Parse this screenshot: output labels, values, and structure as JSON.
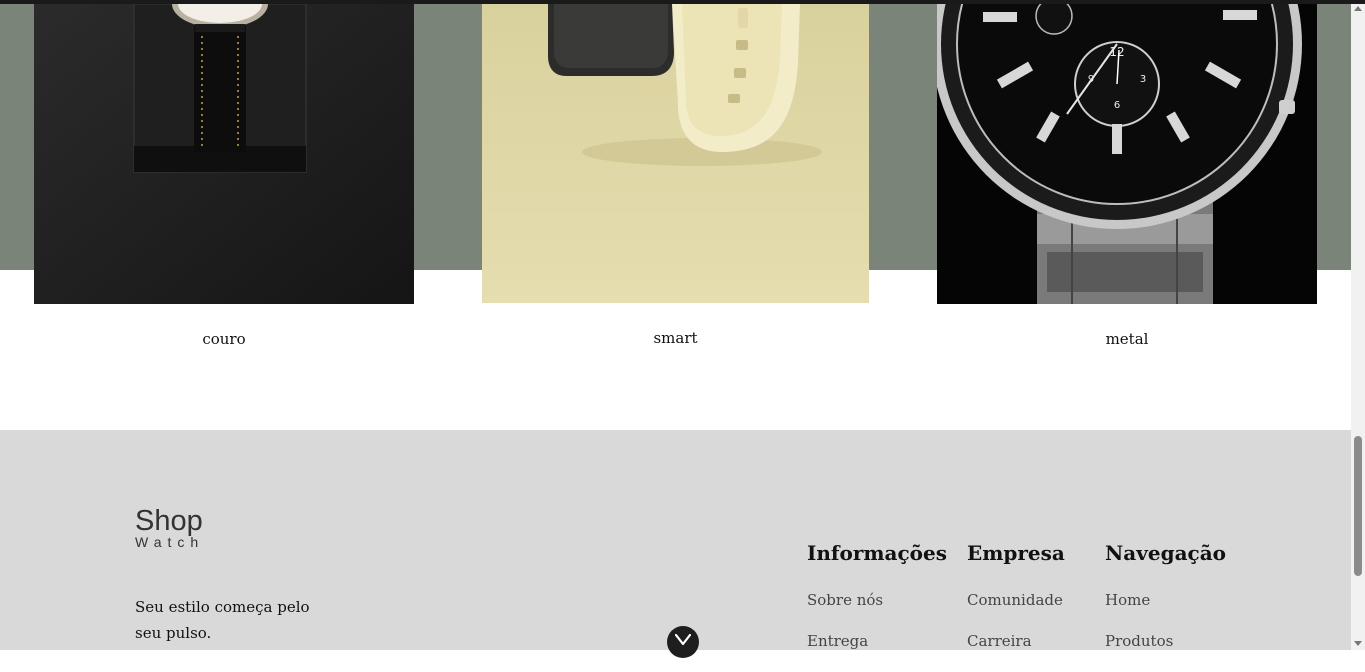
{
  "categories": [
    {
      "label": "couro",
      "image": "leather-watch-image"
    },
    {
      "label": "smart",
      "image": "smart-watch-image"
    },
    {
      "label": "metal",
      "image": "metal-watch-image"
    }
  ],
  "footer": {
    "logo": {
      "line1": "Shop",
      "line2": "Watch"
    },
    "tagline": "Seu estilo começa pelo seu pulso.",
    "columns": [
      {
        "title": "Informações",
        "links": [
          "Sobre nós",
          "Entrega"
        ]
      },
      {
        "title": "Empresa",
        "links": [
          "Comunidade",
          "Carreira"
        ]
      },
      {
        "title": "Navegação",
        "links": [
          "Home",
          "Produtos"
        ]
      }
    ]
  },
  "scroll_button_icon": "chevron-down-icon",
  "colors": {
    "band": "#7b8478",
    "footer_bg": "#d9d9d9",
    "smart_card_bg": "#e1d9a9",
    "text": "#111111",
    "link": "#444444"
  }
}
